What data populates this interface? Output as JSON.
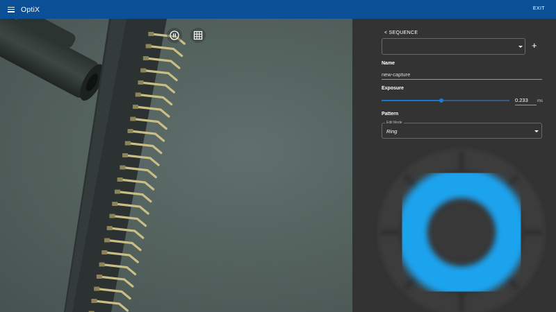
{
  "appbar": {
    "title": "OptiX",
    "exit_label": "EXIT"
  },
  "camera": {
    "pause_icon": "pause-circle-icon",
    "grid_icon": "grid-icon"
  },
  "panel": {
    "sequence_back_label": "< SEQUENCE",
    "sequence_value": "",
    "add_label": "+",
    "name_label": "Name",
    "name_value": "new-capture",
    "exposure_label": "Exposure",
    "exposure_value": "0.233",
    "exposure_unit": "ms",
    "exposure_slider_fraction": 0.47,
    "pattern_label": "Pattern",
    "edit_mode_label": "Edit Mode",
    "edit_mode_value": "Ring"
  },
  "colors": {
    "appbar": "#0b4f97",
    "panel": "#333333",
    "accent": "#1976d2",
    "ring": "#1aa3ee"
  }
}
